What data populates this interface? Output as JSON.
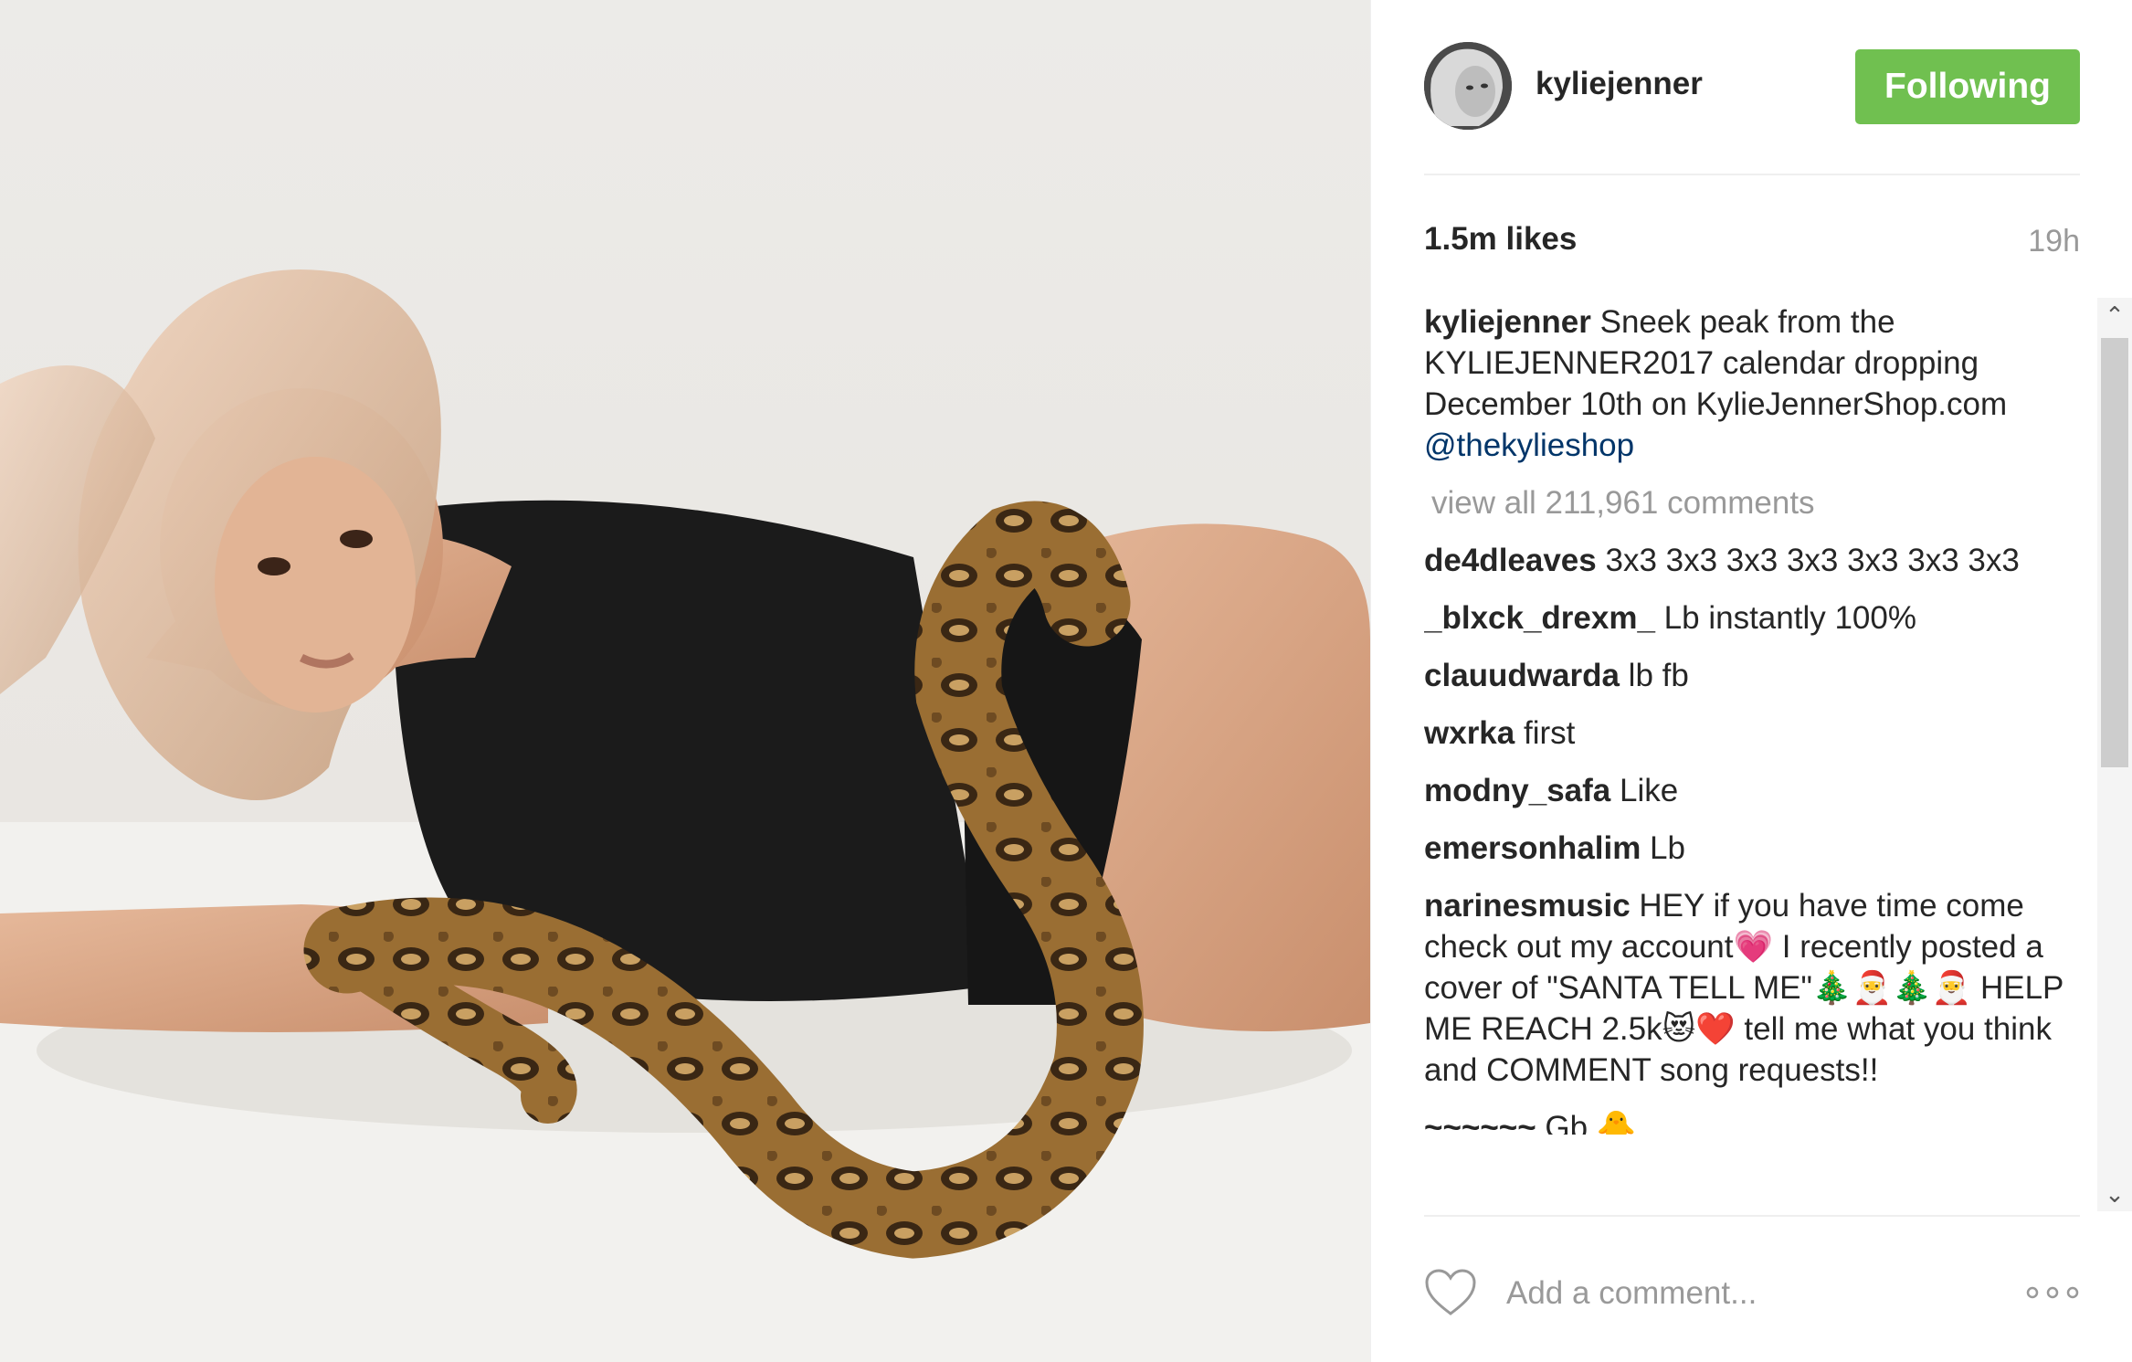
{
  "post": {
    "username": "kyliejenner",
    "follow_label": "Following",
    "likes": "1.5m likes",
    "time": "19h"
  },
  "caption": {
    "user": "kyliejenner",
    "text": " Sneek peak from the KYLIEJENNER2017 calendar dropping December 10th on KylieJennerShop.com",
    "mention": "@thekylieshop"
  },
  "view_all": "view all 211,961 comments",
  "comments": [
    {
      "user": "de4dleaves",
      "text": " 3x3 3x3 3x3 3x3 3x3 3x3 3x3"
    },
    {
      "user": "_blxck_drexm_",
      "text": " Lb instantly 100%"
    },
    {
      "user": "clauudwarda",
      "text": " lb fb"
    },
    {
      "user": "wxrka",
      "text": " first"
    },
    {
      "user": "modny_safa",
      "text": " Like"
    },
    {
      "user": "emersonhalim",
      "text": " Lb"
    },
    {
      "user": "narinesmusic",
      "text": " HEY if you have time come check out my account💗 I recently posted a cover of \"SANTA TELL ME\"🎄🎅🎄🎅 HELP ME REACH 2.5k😻❤️ tell me what you think and COMMENT song requests!!"
    },
    {
      "user": "~~~~~~",
      "text": " Gb 🐥"
    }
  ],
  "add_comment_placeholder": "Add a comment...",
  "icons": {
    "heart": "heart-outline-icon",
    "more": "more-options-icon",
    "scroll_up": "chevron-up-icon",
    "scroll_down": "chevron-down-icon"
  },
  "colors": {
    "follow_button": "#70c050",
    "mention": "#003569",
    "muted": "#999999"
  }
}
